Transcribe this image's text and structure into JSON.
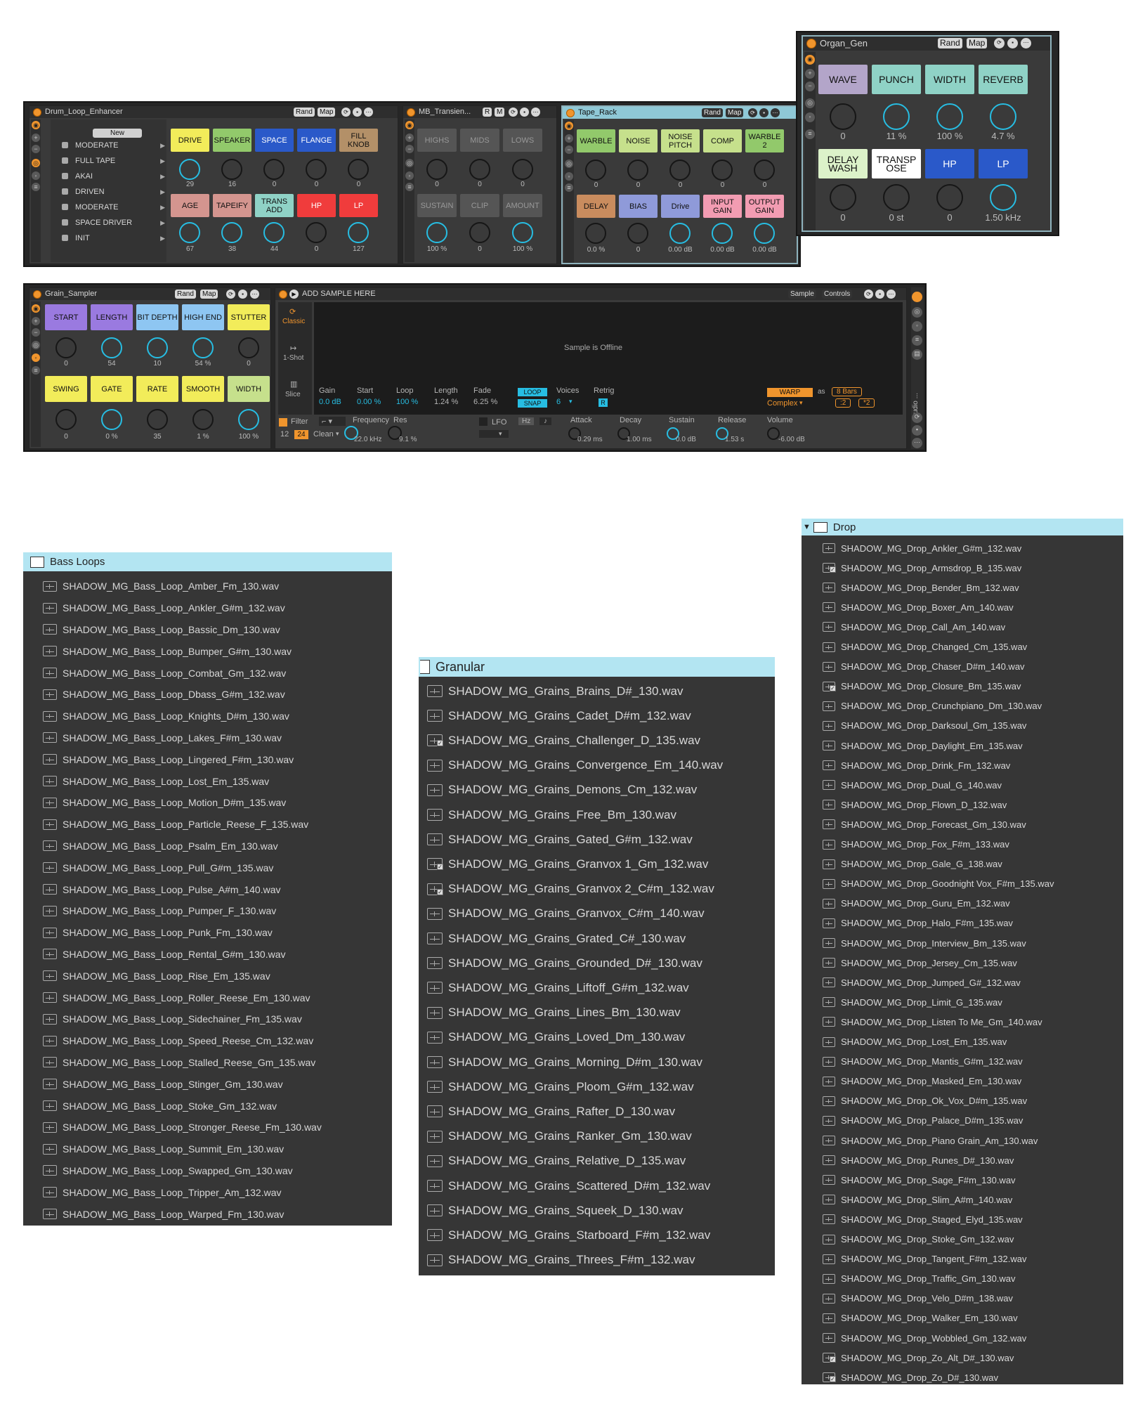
{
  "drum": {
    "title": "Drum_Loop_Enhancer",
    "new_label": "New",
    "rand": "Rand",
    "map": "Map",
    "presets": [
      "MODERATE",
      "FULL TAPE",
      "AKAI",
      "DRIVEN",
      "MODERATE",
      "SPACE DRIVER",
      "INIT"
    ],
    "row1": [
      {
        "label": "DRIVE",
        "value": "29",
        "color": "#f2ec5a"
      },
      {
        "label": "SPEAKER",
        "value": "16",
        "color": "#92c96b"
      },
      {
        "label": "SPACE",
        "value": "0",
        "color": "#2a59c9"
      },
      {
        "label": "FLANGE",
        "value": "0",
        "color": "#2a59c9"
      },
      {
        "label": "FILL KNOB",
        "value": "0",
        "color": "#b39068"
      }
    ],
    "row2": [
      {
        "label": "AGE",
        "value": "67",
        "color": "#d4958f"
      },
      {
        "label": "TAPEIFY",
        "value": "38",
        "color": "#d4958f"
      },
      {
        "label": "TRANS ADD",
        "value": "44",
        "color": "#8fd2c6"
      },
      {
        "label": "HP",
        "value": "0",
        "color": "#f03c3c"
      },
      {
        "label": "LP",
        "value": "127",
        "color": "#f03c3c"
      }
    ]
  },
  "mb": {
    "title": "MB_Transien...",
    "r": "R",
    "m": "M",
    "row1": [
      {
        "label": "HIGHS",
        "value": "0"
      },
      {
        "label": "MIDS",
        "value": "0"
      },
      {
        "label": "LOWS",
        "value": "0"
      }
    ],
    "row2": [
      {
        "label": "SUSTAIN",
        "value": "100 %"
      },
      {
        "label": "CLIP",
        "value": "0"
      },
      {
        "label": "AMOUNT",
        "value": "100 %"
      }
    ]
  },
  "tape": {
    "title": "Tape_Rack",
    "rand": "Rand",
    "map": "Map",
    "row1": [
      {
        "label": "WARBLE",
        "value": "0",
        "color": "#92c96b"
      },
      {
        "label": "NOISE",
        "value": "0",
        "color": "#c6e08c"
      },
      {
        "label": "NOISE PITCH",
        "value": "0",
        "color": "#c6e08c"
      },
      {
        "label": "COMP",
        "value": "0",
        "color": "#c6e08c"
      },
      {
        "label": "WARBLE 2",
        "value": "0",
        "color": "#92c96b"
      }
    ],
    "row2": [
      {
        "label": "DELAY",
        "value": "0.0 %",
        "color": "#c98c5e"
      },
      {
        "label": "BIAS",
        "value": "0",
        "color": "#8f9ad9"
      },
      {
        "label": "Drive",
        "value": "0.00 dB",
        "color": "#8f9ad9"
      },
      {
        "label": "INPUT GAIN",
        "value": "0.00 dB",
        "color": "#f29cb2"
      },
      {
        "label": "OUTPUT GAIN",
        "value": "0.00 dB",
        "color": "#f29cb2"
      }
    ]
  },
  "organ": {
    "title": "Organ_Gen",
    "rand": "Rand",
    "map": "Map",
    "row1": [
      {
        "label": "WAVE",
        "value": "0",
        "color": "#b3a5c9"
      },
      {
        "label": "PUNCH",
        "value": "11 %",
        "color": "#8fd2c6"
      },
      {
        "label": "WIDTH",
        "value": "100 %",
        "color": "#8fd2c6"
      },
      {
        "label": "REVERB",
        "value": "4.7 %",
        "color": "#8fd2c6"
      }
    ],
    "row2": [
      {
        "label": "DELAY WASH",
        "value": "0",
        "color": "#dcf2c9"
      },
      {
        "label": "TRANSP OSE",
        "value": "0 st",
        "color": "#ffffff"
      },
      {
        "label": "HP",
        "value": "0",
        "color": "#2a59c9"
      },
      {
        "label": "LP",
        "value": "1.50 kHz",
        "color": "#2a59c9"
      }
    ]
  },
  "grain": {
    "title": "Grain_Sampler",
    "rand": "Rand",
    "map": "Map",
    "row1": [
      {
        "label": "START",
        "value": "0",
        "color": "#9a7ae0"
      },
      {
        "label": "LENGTH",
        "value": "54",
        "color": "#9a7ae0"
      },
      {
        "label": "BIT DEPTH",
        "value": "10",
        "color": "#8ec6f2"
      },
      {
        "label": "HIGH END",
        "value": "54 %",
        "color": "#8ec6f2"
      },
      {
        "label": "STUTTER",
        "value": "0",
        "color": "#f2ec5a"
      }
    ],
    "row2": [
      {
        "label": "SWING",
        "value": "0",
        "color": "#f2ec5a"
      },
      {
        "label": "GATE",
        "value": "0 %",
        "color": "#f2ec5a"
      },
      {
        "label": "RATE",
        "value": "35",
        "color": "#f2ec5a"
      },
      {
        "label": "SMOOTH",
        "value": "1 %",
        "color": "#f2ec5a"
      },
      {
        "label": "WIDTH",
        "value": "100 %",
        "color": "#c6e08c"
      }
    ]
  },
  "simpler": {
    "title": "ADD SAMPLE HERE",
    "tab_sample": "Sample",
    "tab_controls": "Controls",
    "mode_classic": "Classic",
    "mode_oneshot": "1-Shot",
    "mode_slice": "Slice",
    "offline": "Sample is Offline",
    "gain_label": "Gain",
    "gain_value": "0.0 dB",
    "start_label": "Start",
    "start_value": "0.00 %",
    "loop_label": "Loop",
    "loop_value": "100 %",
    "length_label": "Length",
    "length_value": "1.24 %",
    "fade_label": "Fade",
    "fade_value": "6.25 %",
    "loop_btn": "LOOP",
    "snap_btn": "SNAP",
    "voices_label": "Voices",
    "voices_value": "6",
    "retrig_label": "Retrig",
    "retrig_value": "R",
    "warp_btn": "WARP",
    "as_label": "as",
    "bars_value": "8 Bars",
    "complex_value": "Complex",
    "div_label": ":2",
    "mul_label": "*2",
    "filter_label": "Filter",
    "slope_12": "12",
    "slope_24": "24",
    "clean_value": "Clean",
    "freq_label": "Frequency",
    "freq_value": "22.0 kHz",
    "res_label": "Res",
    "res_value": "9.1 %",
    "lfo_label": "LFO",
    "hz_label": "Hz",
    "attack_label": "Attack",
    "attack_value": "0.29 ms",
    "decay_label": "Decay",
    "decay_value": "1.00 ms",
    "sustain_label": "Sustain",
    "sustain_value": "0.0 dB",
    "release_label": "Release",
    "release_value": "1.53 s",
    "volume_label": "Volume",
    "volume_value": "-6.00 dB",
    "side_label": "Audio ..."
  },
  "bass": {
    "folder": "Bass Loops",
    "files": [
      {
        "name": "SHADOW_MG_Bass_Loop_Amber_Fm_130.wav"
      },
      {
        "name": "SHADOW_MG_Bass_Loop_Ankler_G#m_132.wav"
      },
      {
        "name": "SHADOW_MG_Bass_Loop_Bassic_Dm_130.wav"
      },
      {
        "name": "SHADOW_MG_Bass_Loop_Bumper_G#m_130.wav"
      },
      {
        "name": "SHADOW_MG_Bass_Loop_Combat_Gm_132.wav"
      },
      {
        "name": "SHADOW_MG_Bass_Loop_Dbass_G#m_132.wav"
      },
      {
        "name": "SHADOW_MG_Bass_Loop_Knights_D#m_130.wav"
      },
      {
        "name": "SHADOW_MG_Bass_Loop_Lakes_F#m_130.wav"
      },
      {
        "name": "SHADOW_MG_Bass_Loop_Lingered_F#m_130.wav"
      },
      {
        "name": "SHADOW_MG_Bass_Loop_Lost_Em_135.wav"
      },
      {
        "name": "SHADOW_MG_Bass_Loop_Motion_D#m_135.wav"
      },
      {
        "name": "SHADOW_MG_Bass_Loop_Particle_Reese_F_135.wav"
      },
      {
        "name": "SHADOW_MG_Bass_Loop_Psalm_Em_130.wav"
      },
      {
        "name": "SHADOW_MG_Bass_Loop_Pull_G#m_135.wav"
      },
      {
        "name": "SHADOW_MG_Bass_Loop_Pulse_A#m_140.wav"
      },
      {
        "name": "SHADOW_MG_Bass_Loop_Pumper_F_130.wav"
      },
      {
        "name": "SHADOW_MG_Bass_Loop_Punk_Fm_130.wav"
      },
      {
        "name": "SHADOW_MG_Bass_Loop_Rental_G#m_130.wav"
      },
      {
        "name": "SHADOW_MG_Bass_Loop_Rise_Em_135.wav"
      },
      {
        "name": "SHADOW_MG_Bass_Loop_Roller_Reese_Em_130.wav"
      },
      {
        "name": "SHADOW_MG_Bass_Loop_Sidechainer_Fm_135.wav"
      },
      {
        "name": "SHADOW_MG_Bass_Loop_Speed_Reese_Cm_132.wav"
      },
      {
        "name": "SHADOW_MG_Bass_Loop_Stalled_Reese_Gm_135.wav"
      },
      {
        "name": "SHADOW_MG_Bass_Loop_Stinger_Gm_130.wav"
      },
      {
        "name": "SHADOW_MG_Bass_Loop_Stoke_Gm_132.wav"
      },
      {
        "name": "SHADOW_MG_Bass_Loop_Stronger_Reese_Fm_130.wav"
      },
      {
        "name": "SHADOW_MG_Bass_Loop_Summit_Em_130.wav"
      },
      {
        "name": "SHADOW_MG_Bass_Loop_Swapped_Gm_130.wav"
      },
      {
        "name": "SHADOW_MG_Bass_Loop_Tripper_Am_132.wav"
      },
      {
        "name": "SHADOW_MG_Bass_Loop_Warped_Fm_130.wav"
      }
    ]
  },
  "granular": {
    "folder": "Granular",
    "files": [
      {
        "name": "SHADOW_MG_Grains_Brains_D#_130.wav"
      },
      {
        "name": "SHADOW_MG_Grains_Cadet_D#m_132.wav"
      },
      {
        "name": "SHADOW_MG_Grains_Challenger_D_135.wav",
        "check": true
      },
      {
        "name": "SHADOW_MG_Grains_Convergence_Em_140.wav"
      },
      {
        "name": "SHADOW_MG_Grains_Demons_Cm_132.wav"
      },
      {
        "name": "SHADOW_MG_Grains_Free_Bm_130.wav"
      },
      {
        "name": "SHADOW_MG_Grains_Gated_G#m_132.wav"
      },
      {
        "name": "SHADOW_MG_Grains_Granvox 1_Gm_132.wav",
        "check": true
      },
      {
        "name": "SHADOW_MG_Grains_Granvox 2_C#m_132.wav",
        "check": true
      },
      {
        "name": "SHADOW_MG_Grains_Granvox_C#m_140.wav"
      },
      {
        "name": "SHADOW_MG_Grains_Grated_C#_130.wav"
      },
      {
        "name": "SHADOW_MG_Grains_Grounded_D#_130.wav"
      },
      {
        "name": "SHADOW_MG_Grains_Liftoff_G#m_132.wav"
      },
      {
        "name": "SHADOW_MG_Grains_Lines_Bm_130.wav"
      },
      {
        "name": "SHADOW_MG_Grains_Loved_Dm_130.wav"
      },
      {
        "name": "SHADOW_MG_Grains_Morning_D#m_130.wav"
      },
      {
        "name": "SHADOW_MG_Grains_Ploom_G#m_132.wav"
      },
      {
        "name": "SHADOW_MG_Grains_Rafter_D_130.wav"
      },
      {
        "name": "SHADOW_MG_Grains_Ranker_Gm_130.wav"
      },
      {
        "name": "SHADOW_MG_Grains_Relative_D_135.wav"
      },
      {
        "name": "SHADOW_MG_Grains_Scattered_D#m_132.wav"
      },
      {
        "name": "SHADOW_MG_Grains_Squeek_D_130.wav"
      },
      {
        "name": "SHADOW_MG_Grains_Starboard_F#m_132.wav"
      },
      {
        "name": "SHADOW_MG_Grains_Threes_F#m_132.wav"
      }
    ]
  },
  "drop": {
    "folder": "Drop",
    "files": [
      {
        "name": "SHADOW_MG_Drop_Ankler_G#m_132.wav"
      },
      {
        "name": "SHADOW_MG_Drop_Armsdrop_B_135.wav",
        "check": true
      },
      {
        "name": "SHADOW_MG_Drop_Bender_Bm_132.wav"
      },
      {
        "name": "SHADOW_MG_Drop_Boxer_Am_140.wav"
      },
      {
        "name": "SHADOW_MG_Drop_Call_Am_140.wav"
      },
      {
        "name": "SHADOW_MG_Drop_Changed_Cm_135.wav"
      },
      {
        "name": "SHADOW_MG_Drop_Chaser_D#m_140.wav"
      },
      {
        "name": "SHADOW_MG_Drop_Closure_Bm_135.wav",
        "check": true
      },
      {
        "name": "SHADOW_MG_Drop_Crunchpiano_Dm_130.wav"
      },
      {
        "name": "SHADOW_MG_Drop_Darksoul_Gm_135.wav"
      },
      {
        "name": "SHADOW_MG_Drop_Daylight_Em_135.wav"
      },
      {
        "name": "SHADOW_MG_Drop_Drink_Fm_132.wav"
      },
      {
        "name": "SHADOW_MG_Drop_Dual_G_140.wav"
      },
      {
        "name": "SHADOW_MG_Drop_Flown_D_132.wav"
      },
      {
        "name": "SHADOW_MG_Drop_Forecast_Gm_130.wav"
      },
      {
        "name": "SHADOW_MG_Drop_Fox_F#m_133.wav"
      },
      {
        "name": "SHADOW_MG_Drop_Gale_G_138.wav"
      },
      {
        "name": "SHADOW_MG_Drop_Goodnight Vox_F#m_135.wav"
      },
      {
        "name": "SHADOW_MG_Drop_Guru_Em_132.wav"
      },
      {
        "name": "SHADOW_MG_Drop_Halo_F#m_135.wav"
      },
      {
        "name": "SHADOW_MG_Drop_Interview_Bm_135.wav"
      },
      {
        "name": "SHADOW_MG_Drop_Jersey_Cm_135.wav"
      },
      {
        "name": "SHADOW_MG_Drop_Jumped_G#_132.wav"
      },
      {
        "name": "SHADOW_MG_Drop_Limit_G_135.wav"
      },
      {
        "name": "SHADOW_MG_Drop_Listen To Me_Gm_140.wav"
      },
      {
        "name": "SHADOW_MG_Drop_Lost_Em_135.wav"
      },
      {
        "name": "SHADOW_MG_Drop_Mantis_G#m_132.wav"
      },
      {
        "name": "SHADOW_MG_Drop_Masked_Em_130.wav"
      },
      {
        "name": "SHADOW_MG_Drop_Ok_Vox_D#m_135.wav"
      },
      {
        "name": "SHADOW_MG_Drop_Palace_D#m_135.wav"
      },
      {
        "name": "SHADOW_MG_Drop_Piano Grain_Am_130.wav"
      },
      {
        "name": "SHADOW_MG_Drop_Runes_D#_130.wav"
      },
      {
        "name": "SHADOW_MG_Drop_Sage_F#m_130.wav"
      },
      {
        "name": "SHADOW_MG_Drop_Slim_A#m_140.wav"
      },
      {
        "name": "SHADOW_MG_Drop_Staged_Elyd_135.wav"
      },
      {
        "name": "SHADOW_MG_Drop_Stoke_Gm_132.wav"
      },
      {
        "name": "SHADOW_MG_Drop_Tangent_F#m_132.wav"
      },
      {
        "name": "SHADOW_MG_Drop_Traffic_Gm_130.wav"
      },
      {
        "name": "SHADOW_MG_Drop_Velo_D#m_138.wav"
      },
      {
        "name": "SHADOW_MG_Drop_Walker_Em_130.wav"
      },
      {
        "name": "SHADOW_MG_Drop_Wobbled_Gm_132.wav"
      },
      {
        "name": "SHADOW_MG_Drop_Zo_Alt_D#_130.wav",
        "check": true
      },
      {
        "name": "SHADOW_MG_Drop_Zo_D#_130.wav",
        "check": true
      }
    ]
  }
}
